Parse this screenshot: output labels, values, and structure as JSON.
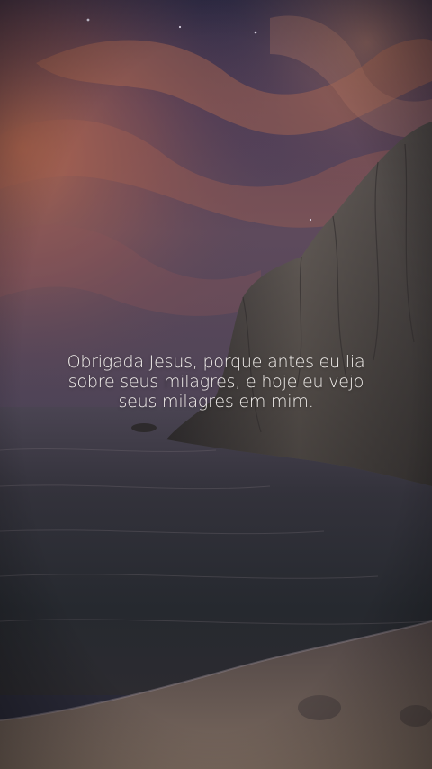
{
  "caption": {
    "line1": "Obrigada Jesus, porque antes eu lia",
    "line2": "sobre seus milagres, e hoje eu vejo",
    "line3": "seus milagres em mim."
  },
  "colors": {
    "sky_top": "#2c2b45",
    "sky_glow": "#b3674a",
    "sea": "#262a33",
    "sand": "#6e5e55",
    "cliff": "#5b5552",
    "text": "#f4f1ee"
  }
}
